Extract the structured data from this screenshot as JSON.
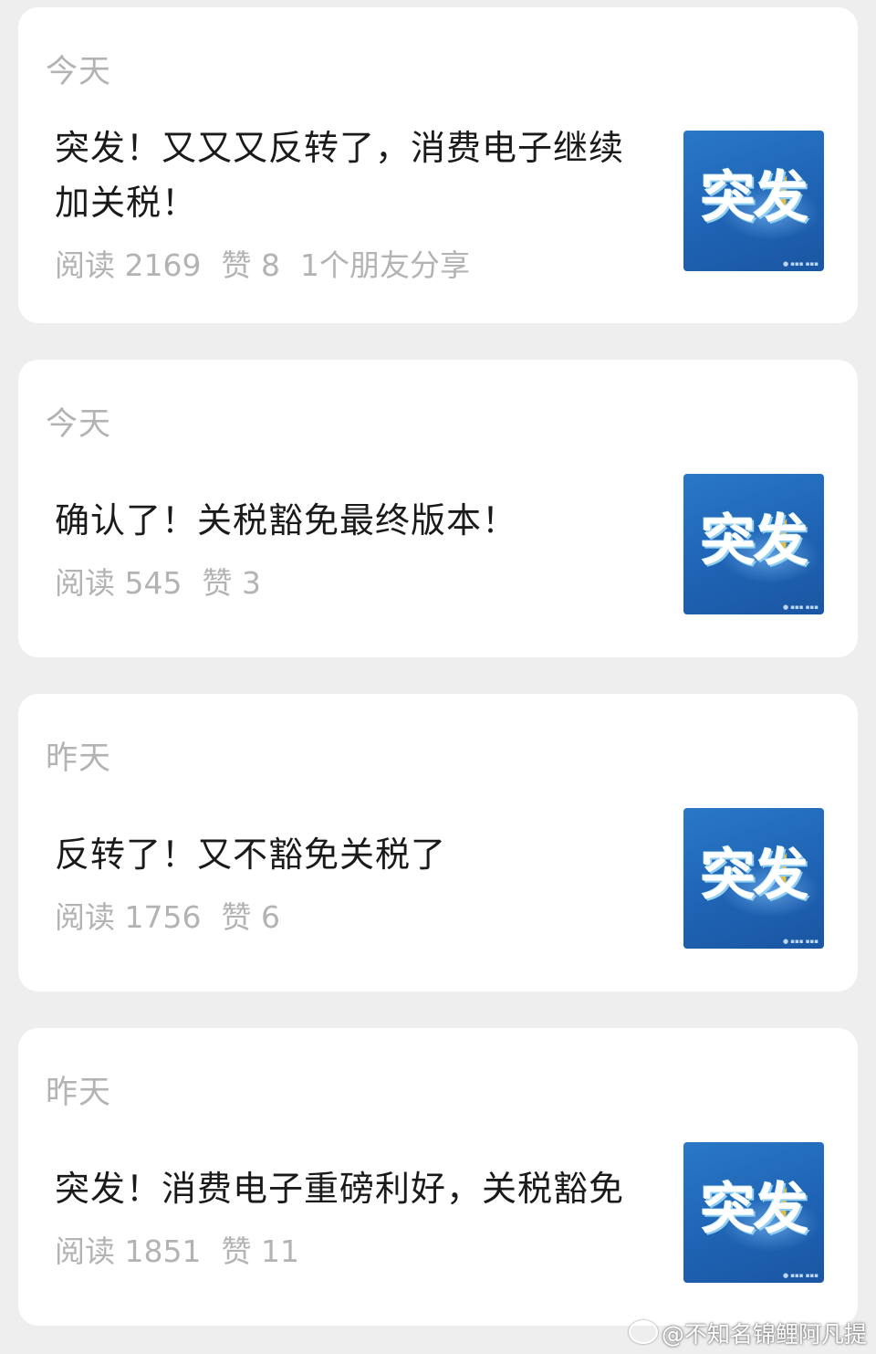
{
  "articles": [
    {
      "date": "今天",
      "title": "突发！又又又反转了，消费电子继续加关税！",
      "reads": "阅读 2169",
      "likes": "赞 8",
      "shares": "1个朋友分享",
      "thumb_text": "突发"
    },
    {
      "date": "今天",
      "title": "确认了！关税豁免最终版本！",
      "reads": "阅读 545",
      "likes": "赞 3",
      "thumb_text": "突发"
    },
    {
      "date": "昨天",
      "title": "反转了！又不豁免关税了",
      "reads": "阅读 1756",
      "likes": "赞 6",
      "thumb_text": "突发"
    },
    {
      "date": "昨天",
      "title": "突发！消费电子重磅利好，关税豁免",
      "reads": "阅读 1851",
      "likes": "赞 11",
      "thumb_text": "突发"
    }
  ],
  "watermark": {
    "text": "@不知名锦鲤阿凡提",
    "icon": "weibo-icon"
  },
  "colors": {
    "background": "#eeeeee",
    "card": "#ffffff",
    "muted_text": "#b3b3b3",
    "title_text": "#1a1a1a",
    "thumb_blue": "#1f63b4",
    "thumb_star": "#f3c531"
  }
}
